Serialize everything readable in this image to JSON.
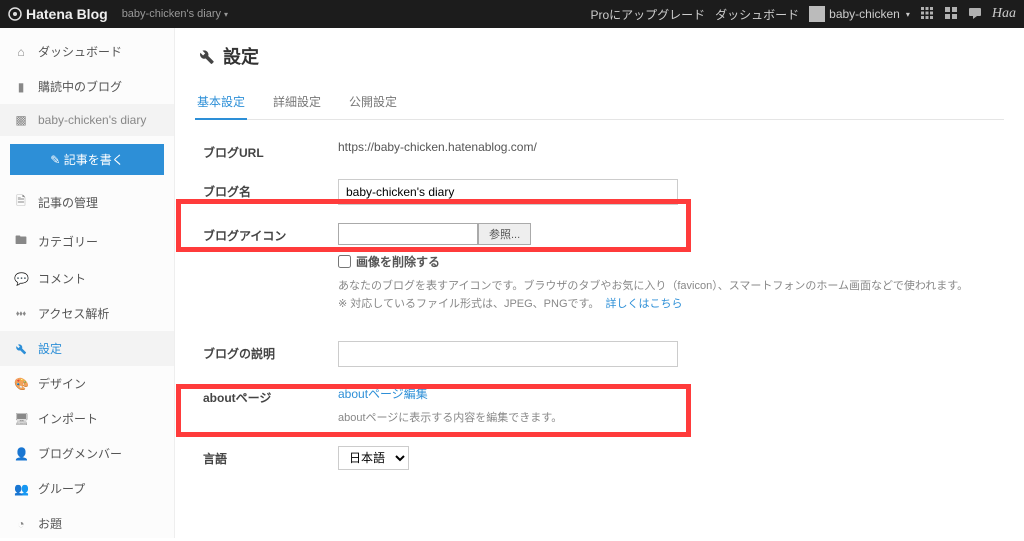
{
  "topbar": {
    "logo": "Hatena Blog",
    "blog_selector": "baby-chicken's diary",
    "upgrade": "Proにアップグレード",
    "dashboard": "ダッシュボード",
    "username": "baby-chicken",
    "brand_suffix": "Haa"
  },
  "sidebar": {
    "dashboard": "ダッシュボード",
    "subscriptions": "購読中のブログ",
    "current_blog": "baby-chicken's diary",
    "write": "記事を書く",
    "manage": "記事の管理",
    "category": "カテゴリー",
    "comment": "コメント",
    "analytics": "アクセス解析",
    "settings": "設定",
    "design": "デザイン",
    "import": "インポート",
    "members": "ブログメンバー",
    "group": "グループ",
    "odai": "お題"
  },
  "page": {
    "title": "設定",
    "tabs": {
      "basic": "基本設定",
      "detail": "詳細設定",
      "publish": "公開設定"
    }
  },
  "form": {
    "url_label": "ブログURL",
    "url_value": "https://baby-chicken.hatenablog.com/",
    "name_label": "ブログ名",
    "name_value": "baby-chicken's diary",
    "icon_label": "ブログアイコン",
    "icon_browse": "参照...",
    "icon_delete": "画像を削除する",
    "icon_desc1": "あなたのブログを表すアイコンです。ブラウザのタブやお気に入り（favicon）、スマートフォンのホーム画面などで使われます。",
    "icon_desc2": "※ 対応しているファイル形式は、JPEG、PNGです。",
    "icon_link": "詳しくはこちら",
    "desc_label": "ブログの説明",
    "desc_value": "",
    "about_label": "aboutページ",
    "about_link": "aboutページ編集",
    "about_desc": "aboutページに表示する内容を編集できます。",
    "lang_label": "言語",
    "lang_value": "日本語"
  }
}
